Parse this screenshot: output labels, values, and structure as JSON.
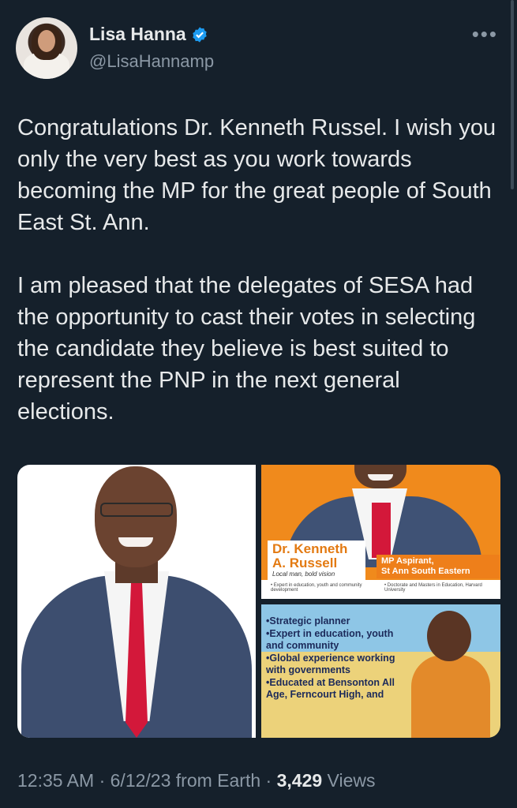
{
  "author": {
    "name": "Lisa Hanna",
    "handle": "@LisaHannamp",
    "verified": true,
    "avatar_icon": "profile-photo"
  },
  "more_icon": "more-dots-icon",
  "tweet": {
    "paragraphs": [
      "Congratulations Dr. Kenneth Russel. I wish you only the very best as you work towards becoming the MP for the great people of South East St. Ann.",
      "I am pleased that the delegates of SESA had the opportunity to cast their votes in selecting the candidate they believe is best suited to represent the PNP in the next general elections."
    ]
  },
  "media": {
    "flyer_top": {
      "name_line1": "Dr. Kenneth",
      "name_line2": "A. Russell",
      "tagline": "Local man, bold vision",
      "role_line1": "MP Aspirant,",
      "role_line2": "St Ann South Eastern",
      "small_left": "• Expert in education, youth and community development",
      "small_right": "• Doctorate and Masters in Education, Harvard University"
    },
    "flyer_bottom": {
      "bullets": [
        "•Strategic planner",
        "•Expert in education, youth and community",
        "•Global experience working with governments",
        "•Educated at Bensonton All Age, Ferncourt High, and"
      ]
    }
  },
  "footer": {
    "time": "12:35 AM",
    "sep1": " · ",
    "date": "6/12/23",
    "source": " from Earth",
    "sep2": " · ",
    "views_count": "3,429",
    "views_label": " Views"
  },
  "colors": {
    "background": "#15202b",
    "text": "#e7e9ea",
    "muted": "#8b98a5",
    "verified": "#1d9bf0"
  }
}
